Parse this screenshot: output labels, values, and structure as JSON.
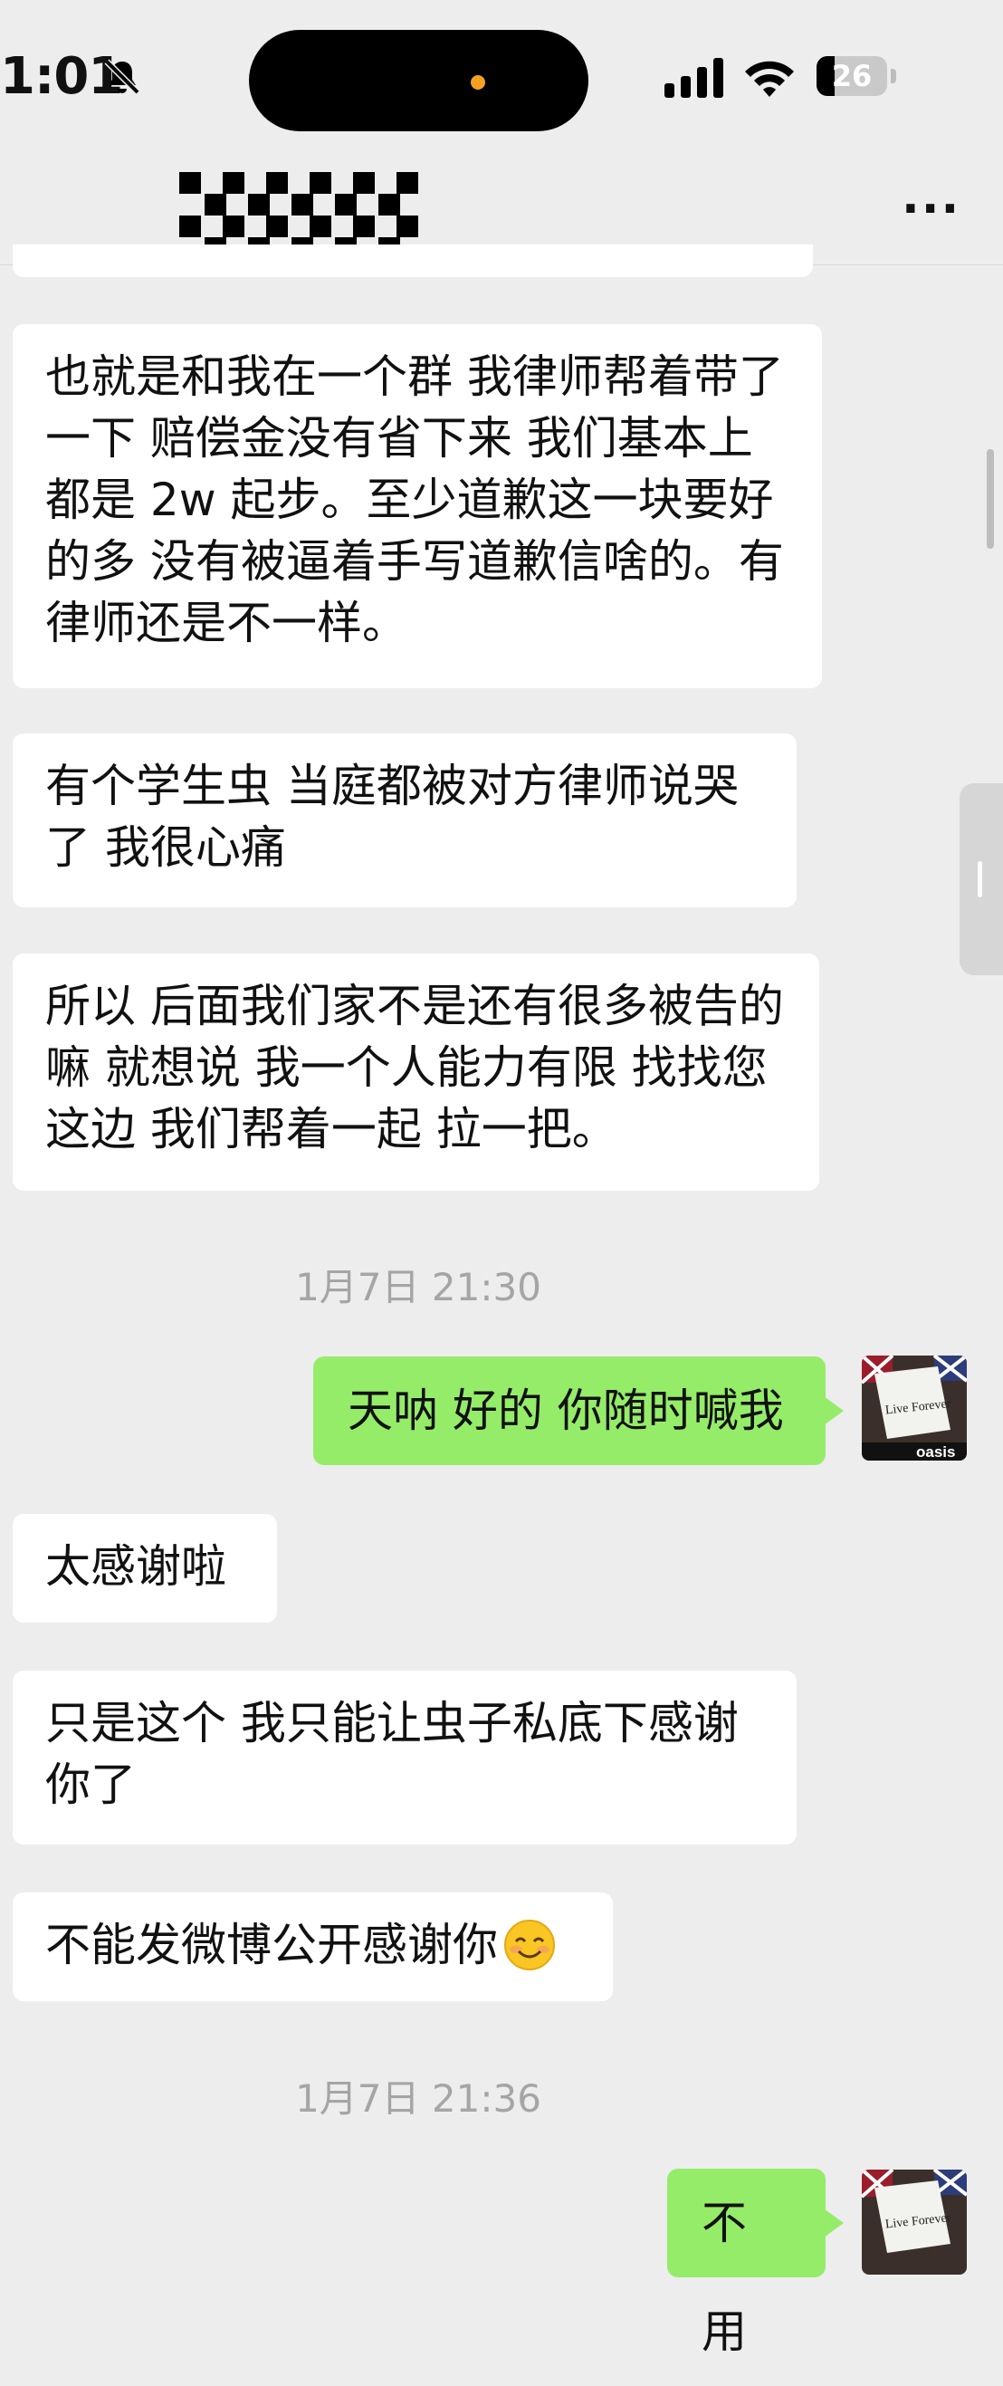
{
  "status_bar": {
    "time": "1:01",
    "battery_level": "26",
    "icons": [
      "bell-muted-icon",
      "cellular-signal-icon",
      "wifi-icon",
      "battery-icon"
    ]
  },
  "nav": {
    "title": "",
    "more_label": "···"
  },
  "messages": [
    {
      "side": "left",
      "text": "也就是和我在一个群 我律师帮着带了一下 赔偿金没有省下来 我们基本上都是 2w 起步。至少道歉这一块要好的多 没有被逼着手写道歉信啥的。有律师还是不一样。"
    },
    {
      "side": "left",
      "text": "有个学生虫 当庭都被对方律师说哭了 我很心痛"
    },
    {
      "side": "left",
      "text": "所以 后面我们家不是还有很多被告的嘛 就想说 我一个人能力有限 找找您这边 我们帮着一起 拉一把。"
    },
    {
      "timestamp": "1月7日 21:30"
    },
    {
      "side": "right",
      "text": "天呐 好的 你随时喊我"
    },
    {
      "side": "left",
      "text": "太感谢啦"
    },
    {
      "side": "left",
      "text": "只是这个 我只能让虫子私底下感谢你了"
    },
    {
      "side": "left",
      "text": "不能发微博公开感谢你",
      "emoji": "smiling-face-emoji"
    },
    {
      "timestamp": "1月7日 21:36"
    },
    {
      "side": "right",
      "text": "不用"
    }
  ],
  "avatar": {
    "sign_text": "Live Forever",
    "brand_text": "oasis"
  },
  "colors": {
    "background": "#ededed",
    "incoming_bubble": "#ffffff",
    "outgoing_bubble": "#95ec69",
    "timestamp": "#a5a5a5"
  }
}
